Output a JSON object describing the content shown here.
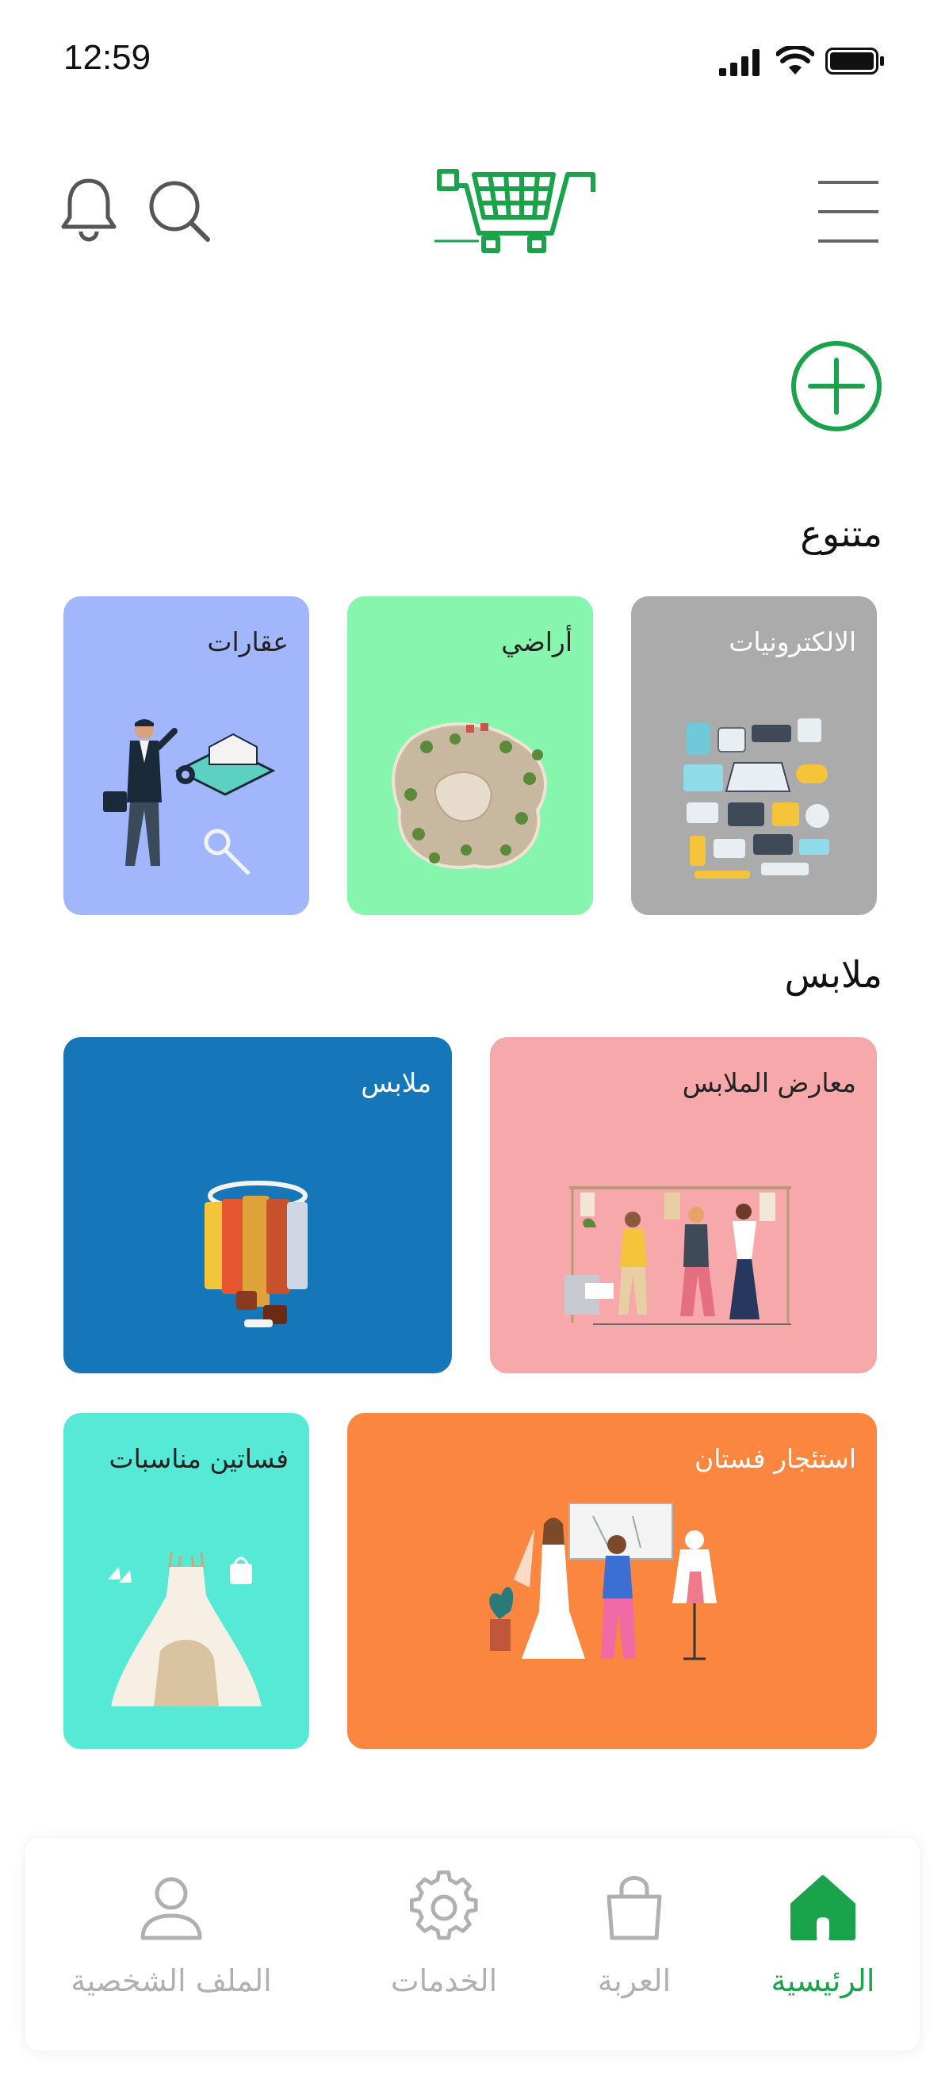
{
  "status_bar": {
    "time": "12:59",
    "icons": [
      "cellular-signal-icon",
      "wifi-icon",
      "battery-icon"
    ]
  },
  "header": {
    "icons": [
      "bell-icon",
      "search-icon",
      "cart-logo-icon",
      "menu-icon"
    ],
    "brand_color": "#1aa34a"
  },
  "add_button": {
    "icon": "plus-circle-icon"
  },
  "sections": {
    "varied": {
      "title": "متنوع"
    },
    "clothes": {
      "title": "ملابس"
    }
  },
  "cards": {
    "electronics": {
      "label": "الالكترونيات",
      "color": "#ababab",
      "art": "electronics-illustration"
    },
    "lands": {
      "label": "أراضي",
      "color": "#86f5ad",
      "art": "land-map-illustration"
    },
    "real_estate": {
      "label": "عقارات",
      "color": "#a2b6fc",
      "art": "real-estate-agent-illustration"
    },
    "clothing_showrooms": {
      "label": "معارض الملابس",
      "color": "#f6a8ab",
      "art": "clothing-store-illustration"
    },
    "clothes": {
      "label": "ملابس",
      "color": "#1576b8",
      "art": "clothing-rack-illustration"
    },
    "dress_rental": {
      "label": "استئجار فستان",
      "color": "#fb8640",
      "art": "bridal-shop-illustration"
    },
    "occasion_dresses": {
      "label": "فساتين مناسبات",
      "color": "#56ead6",
      "art": "wedding-dress-illustration"
    }
  },
  "bottom_nav": {
    "items": [
      {
        "label": "الرئيسية",
        "icon": "home-icon",
        "active": true
      },
      {
        "label": "العربة",
        "icon": "shopping-bag-icon",
        "active": false
      },
      {
        "label": "الخدمات",
        "icon": "gear-icon",
        "active": false
      },
      {
        "label": "الملف الشخصية",
        "icon": "user-icon",
        "active": false
      }
    ]
  }
}
